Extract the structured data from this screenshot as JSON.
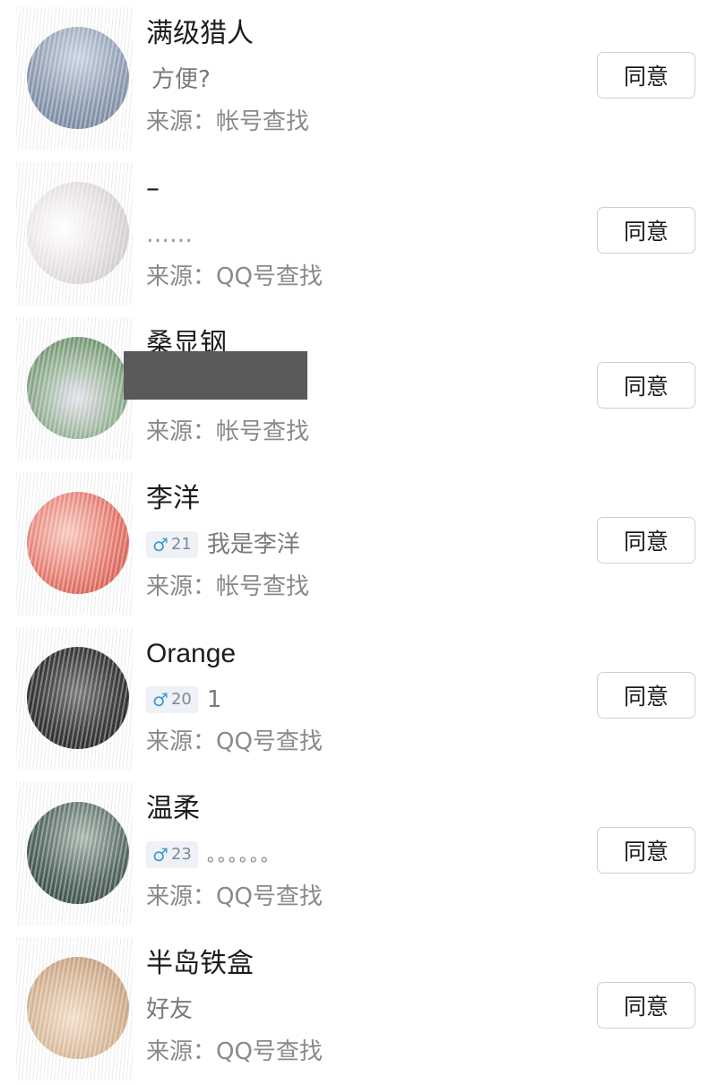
{
  "requests": [
    {
      "name": "满级猎人",
      "tag": null,
      "message": "方便?",
      "source": "来源：帐号查找",
      "button": "同意",
      "avatar_colors": [
        "#c9d3df",
        "#6d7f99"
      ]
    },
    {
      "name": "–",
      "tag": null,
      "message": "……",
      "source": "来源：QQ号查找",
      "button": "同意",
      "avatar_colors": [
        "#eeeaea",
        "#c4bcbc"
      ]
    },
    {
      "name": "桑显钢",
      "tag": null,
      "message": "",
      "source": "来源：帐号查找",
      "button": "同意",
      "avatar_colors": [
        "#dce4dc",
        "#5f8a5f"
      ],
      "redacted": true
    },
    {
      "name": "李洋",
      "tag": {
        "symbol": "♂",
        "age": "21"
      },
      "message": "我是李洋",
      "source": "来源：帐号查找",
      "button": "同意",
      "avatar_colors": [
        "#f2b3aa",
        "#d9584c"
      ]
    },
    {
      "name": "Orange",
      "tag": {
        "symbol": "♂",
        "age": "20"
      },
      "message": "1",
      "source": "来源：QQ号查找",
      "button": "同意",
      "avatar_colors": [
        "#6a6a6a",
        "#1e1e1e"
      ]
    },
    {
      "name": "温柔",
      "tag": {
        "symbol": "♂",
        "age": "23"
      },
      "message": "。。。。。。",
      "source": "来源：QQ号查找",
      "button": "同意",
      "avatar_colors": [
        "#7e8c84",
        "#2b3c37"
      ]
    },
    {
      "name": "半岛铁盒",
      "tag": null,
      "message": "好友",
      "source": "来源：QQ号查找",
      "button": "同意",
      "avatar_colors": [
        "#e8d2bf",
        "#c09a7b"
      ]
    }
  ]
}
